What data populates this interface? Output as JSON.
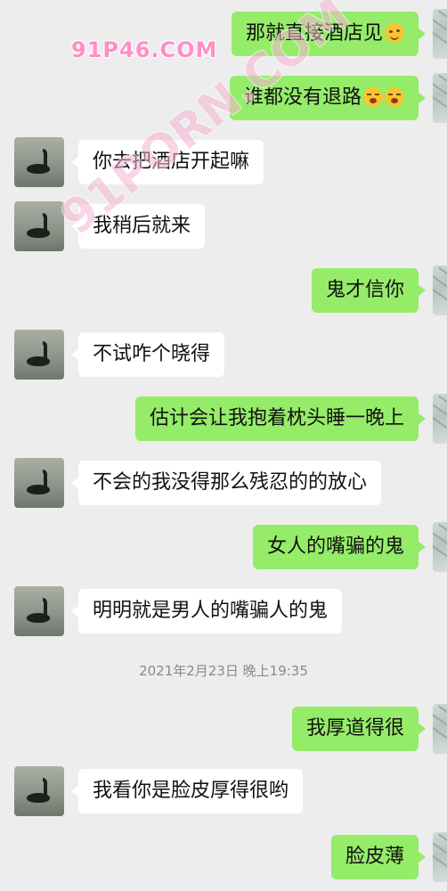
{
  "watermarks": {
    "top": "91P46.COM",
    "diagonal": "91PORN.COM"
  },
  "messages": [
    {
      "side": "out",
      "text": "那就直接酒店见",
      "emoji": [
        "wink"
      ]
    },
    {
      "side": "out",
      "text": "谁都没有退路",
      "emoji": [
        "yawn",
        "yawn"
      ]
    },
    {
      "side": "in",
      "text": "你去把酒店开起嘛"
    },
    {
      "side": "in",
      "text": "我稍后就来"
    },
    {
      "side": "out",
      "text": "鬼才信你"
    },
    {
      "side": "in",
      "text": "不试咋个晓得"
    },
    {
      "side": "out",
      "text": "估计会让我抱着枕头睡一晚上"
    },
    {
      "side": "in",
      "text": "不会的我没得那么残忍的的放心"
    },
    {
      "side": "out",
      "text": "女人的嘴骗的鬼"
    },
    {
      "side": "in",
      "text": "明明就是男人的嘴骗人的鬼"
    },
    {
      "type": "timestamp",
      "text": "2021年2月23日 晚上19:35"
    },
    {
      "side": "out",
      "text": "我厚道得很"
    },
    {
      "side": "in",
      "text": "我看你是脸皮厚得很哟"
    },
    {
      "side": "out",
      "text": "脸皮薄"
    }
  ]
}
